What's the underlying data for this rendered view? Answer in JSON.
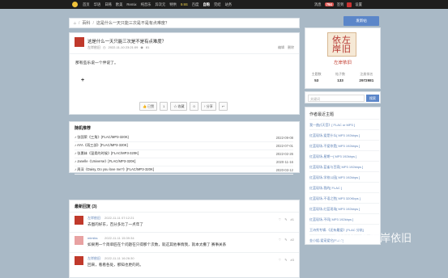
{
  "topbar": {
    "nav": [
      "首页",
      "华语",
      "日韩",
      "欧美",
      "Remix",
      "纯音乐",
      "异次元",
      "特供",
      "9.9S",
      "百度",
      "自购",
      "完结",
      "站务"
    ],
    "right": [
      "消息",
      "794",
      "签到",
      "设置"
    ]
  },
  "breadcrumb": {
    "home_icon": "home-icon",
    "items": [
      "百科",
      "这是什么一天只能三次是不是有点难度？"
    ]
  },
  "post": {
    "title": "这是什么一天只能三次是不是有点难度？",
    "author": "左岸依旧",
    "date": "2022-11-10 23:21:09",
    "views": "81",
    "edit": "编辑",
    "delete": "删除",
    "body": "那有些乐说一个伴说了。",
    "buttons": [
      "👍 已赞",
      "1",
      "☆ 收藏",
      "0",
      "↑ 分享",
      "↩"
    ]
  },
  "music": {
    "title": "随机推荐",
    "rows": [
      {
        "text": "♪ 张国荣《三角》(FLAC/MP3-320K)",
        "date": "2022-09-08"
      },
      {
        "text": "♪ AYA《雨三部》[FLAC/MP3-320K]",
        "date": "2022-07-01"
      },
      {
        "text": "♪ 张惠妹《温柔的时候》[FLAC/MP3-320K]",
        "date": "2022-02-26"
      },
      {
        "text": "♪ Janelle《Universe》[FLAC/MP3-320K]",
        "date": "2020-11-16"
      },
      {
        "text": "♪ 周深《Daisy, Do you love me?》[FLAC/MP3-320K]",
        "date": "2020-03-12"
      }
    ]
  },
  "replies": {
    "title": "最新回复 (3)",
    "items": [
      {
        "name": "左岸依旧",
        "time": "2022-11-11 07:12:21",
        "text": "去图的好东，百分多比了一点年了",
        "floor": "#1",
        "color": "#c0392b"
      },
      {
        "name": "mimiks",
        "time": "2022-11-11 15:39:34",
        "text": "如果用一个简单匠在个问题在只得那个次数，就这其他事情我，就本太撒了 赛事关系",
        "floor": "#2",
        "color": "#e8a2a2"
      },
      {
        "name": "左岸依旧",
        "time": "2022-11-11 16:26:30",
        "text": "回来，看看各处，那知也更的的。",
        "floor": "#3",
        "color": "#c0392b"
      }
    ]
  },
  "sidebar": {
    "post_button": "发新帖",
    "seal_text": "依左岸旧",
    "username": "左岸依旧",
    "stats": [
      {
        "label": "主题数",
        "value": "53"
      },
      {
        "label": "帖子数",
        "value": "133"
      },
      {
        "label": "注册排名",
        "value": "2972981"
      }
    ]
  },
  "search": {
    "placeholder": "关键词",
    "button": "搜索"
  },
  "songs": {
    "title": "作者最近主题",
    "items": [
      "我一曲(《天音》[ FLAC or MP3 ]",
      "红蓝现场-爱是什么[ MP3 192kbps ]",
      "红蓝现场-不爱你是[ MP3 192kbps ]",
      "红蓝现场-星期一[ MP3 192kbps ]",
      "红蓝现场-蓝雀与百家[ MP3 192kbps ]",
      "红蓝现场-学校公园[ MP3 192kbps ]",
      "红蓝现场-我的[ FLAC ]",
      "红蓝现场-不语之愁[ MP3 320Kbps ]",
      "红蓝现场-红蓝现场[ MP3 192kbps ]",
      "红蓝现场-不同[ MP3 192kbps ]",
      "王诗秀专辑-《还有最爱》[FLAC 分轨]",
      "金小姐-爱宠爱它[FLAC]"
    ]
  },
  "watermark": "知乎 @左岸依旧"
}
